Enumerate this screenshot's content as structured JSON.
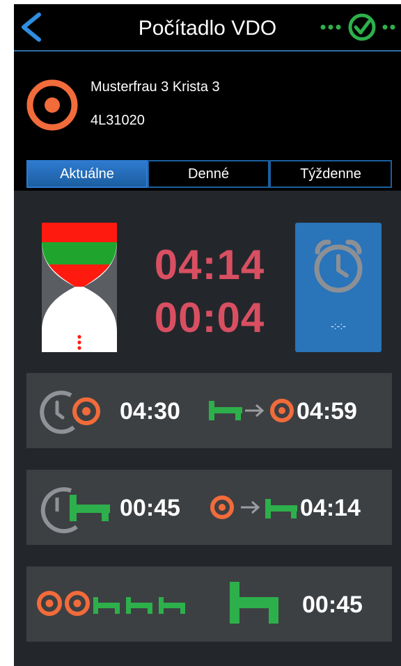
{
  "header": {
    "title": "Počítadlo VDO"
  },
  "driver": {
    "name": "Musterfrau 3 Krista 3",
    "card_id": "4L31020"
  },
  "tabs": [
    {
      "label": "Aktuálne",
      "active": true
    },
    {
      "label": "Denné",
      "active": false
    },
    {
      "label": "Týždenne",
      "active": false
    }
  ],
  "summary": {
    "time_primary": "04:14",
    "time_secondary": "00:04"
  },
  "alarm": {
    "value": "-:-:-"
  },
  "rows": [
    {
      "left_time": "04:30",
      "right_time": "04:59"
    },
    {
      "left_time": "00:45",
      "right_time": "04:14"
    },
    {
      "right_time": "00:45"
    }
  ],
  "colors": {
    "accent_blue": "#2f7ad0",
    "drive_orange": "#f26b3a",
    "rest_green": "#2db04b",
    "time_red": "#d94f62",
    "row_gray": "#3d4043"
  }
}
